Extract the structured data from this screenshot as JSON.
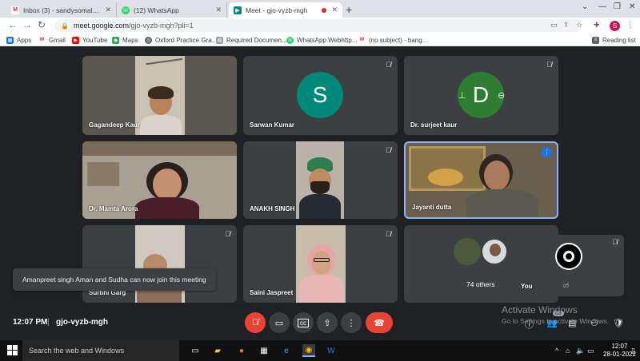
{
  "browser": {
    "tabs": [
      {
        "title": "Inbox (3) - sandysomal@gmail.c",
        "icon": "gmail-icon",
        "color": "#d93025"
      },
      {
        "title": "(12) WhatsApp",
        "icon": "whatsapp-icon",
        "color": "#25d366"
      },
      {
        "title": "Meet - gjo-vyzb-mgh",
        "icon": "meet-icon",
        "color": "#00897b",
        "active": true
      }
    ],
    "url_main": "meet.google.com",
    "url_path": "/gjo-vyzb-mgh?pli=1",
    "profile_initial": "S",
    "reading_list": "Reading list",
    "bookmarks": [
      {
        "label": "Apps",
        "color": "#1a73e8"
      },
      {
        "label": "Gmail",
        "color": "#d93025"
      },
      {
        "label": "YouTube",
        "color": "#ff0000"
      },
      {
        "label": "Maps",
        "color": "#34a853"
      },
      {
        "label": "Oxford Practice Gra...",
        "color": "#5f6368"
      },
      {
        "label": "Required Documen...",
        "color": "#9aa0a6"
      },
      {
        "label": "WhatsApp Webhttp...",
        "color": "#25d366"
      },
      {
        "label": "(no subject) - bang...",
        "color": "#d93025"
      }
    ]
  },
  "participants": [
    {
      "name": "Gagandeep Kaur",
      "muted": false
    },
    {
      "name": "Sarwan Kumar",
      "muted": true,
      "initial": "S",
      "color": "#00897b"
    },
    {
      "name": "Dr. surjeet kaur",
      "muted": true,
      "initial": "D",
      "color": "#2e7d32"
    },
    {
      "name": "Dr. Mamta Arora",
      "muted": false
    },
    {
      "name": "ANAKH SINGH",
      "muted": true
    },
    {
      "name": "Jayanti dutta",
      "muted": false,
      "speaking": true
    },
    {
      "name": "Surbhi Garg",
      "muted": true
    },
    {
      "name": "Saini Jaspreet",
      "muted": true
    },
    {
      "others_label": "74 others"
    }
  ],
  "self_view": {
    "name": "You"
  },
  "toast": "Amanpreet singh Aman and Sudha can now join this meeting",
  "bottom": {
    "time": "12:07 PM",
    "separator": "|",
    "meeting_code": "gjo-vyzb-mgh",
    "participant_count": "83"
  },
  "watermark": {
    "line1": "Activate Windows",
    "line2": "Go to Settings to activate Windows."
  },
  "taskbar": {
    "search_placeholder": "Search the web and Windows",
    "time": "12:07",
    "date": "28-01-2022"
  }
}
